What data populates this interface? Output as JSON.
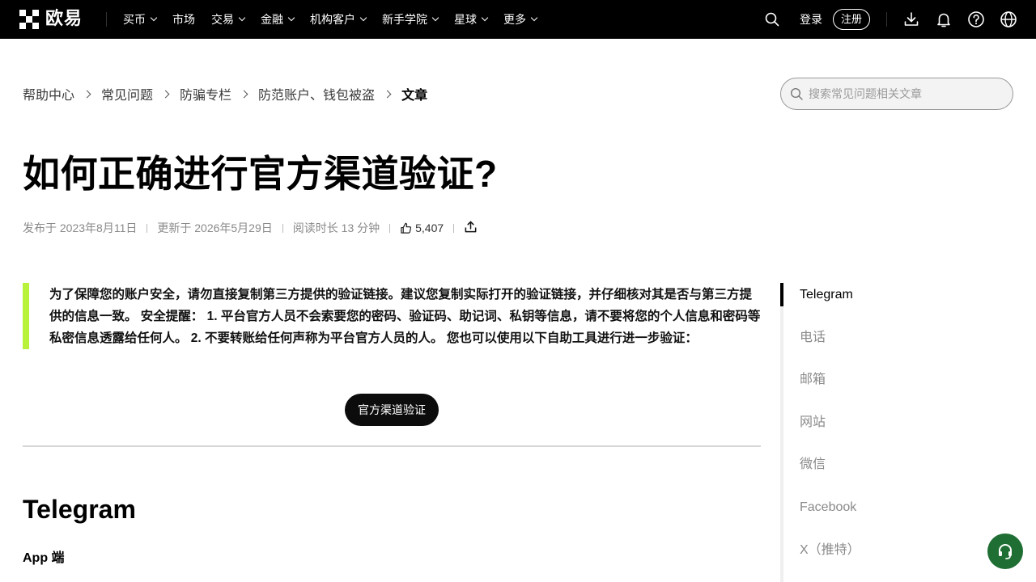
{
  "header": {
    "logo_text": "欧易",
    "nav": [
      {
        "label": "买币",
        "has_dropdown": true
      },
      {
        "label": "市场",
        "has_dropdown": false
      },
      {
        "label": "交易",
        "has_dropdown": true
      },
      {
        "label": "金融",
        "has_dropdown": true
      },
      {
        "label": "机构客户",
        "has_dropdown": true
      },
      {
        "label": "新手学院",
        "has_dropdown": true
      },
      {
        "label": "星球",
        "has_dropdown": true
      },
      {
        "label": "更多",
        "has_dropdown": true
      }
    ],
    "login_label": "登录",
    "register_label": "注册",
    "icons": [
      "search-icon",
      "download-icon",
      "bell-icon",
      "help-icon",
      "globe-icon"
    ]
  },
  "breadcrumb": {
    "items": [
      "帮助中心",
      "常见问题",
      "防骗专栏",
      "防范账户、钱包被盗"
    ],
    "current": "文章"
  },
  "search": {
    "placeholder": "搜索常见问题相关文章"
  },
  "article": {
    "title": "如何正确进行官方渠道验证?",
    "published": "发布于 2023年8月11日",
    "updated": "更新于 2026年5月29日",
    "read_time": "阅读时长 13 分钟",
    "likes": "5,407",
    "notice": "为了保障您的账户安全，请勿直接复制第三方提供的验证链接。建议您复制实际打开的验证链接，并仔细核对其是否与第三方提供的信息一致。 安全提醒： 1. 平台官方人员不会索要您的密码、验证码、助记词、私钥等信息，请不要将您的个人信息和密码等私密信息透露给任何人。 2. 不要转账给任何声称为平台官方人员的人。 您也可以使用以下自助工具进行进一步验证：",
    "verify_button": "官方渠道验证",
    "section_title": "Telegram",
    "sub_title": "App 端"
  },
  "toc": {
    "active_index": 0,
    "items": [
      "Telegram",
      "电话",
      "邮箱",
      "网站",
      "微信",
      "Facebook",
      "X（推特）"
    ]
  },
  "colors": {
    "accent_bar": "#b9f23a",
    "support_button": "#1f6e33",
    "header_bg": "#000000"
  }
}
